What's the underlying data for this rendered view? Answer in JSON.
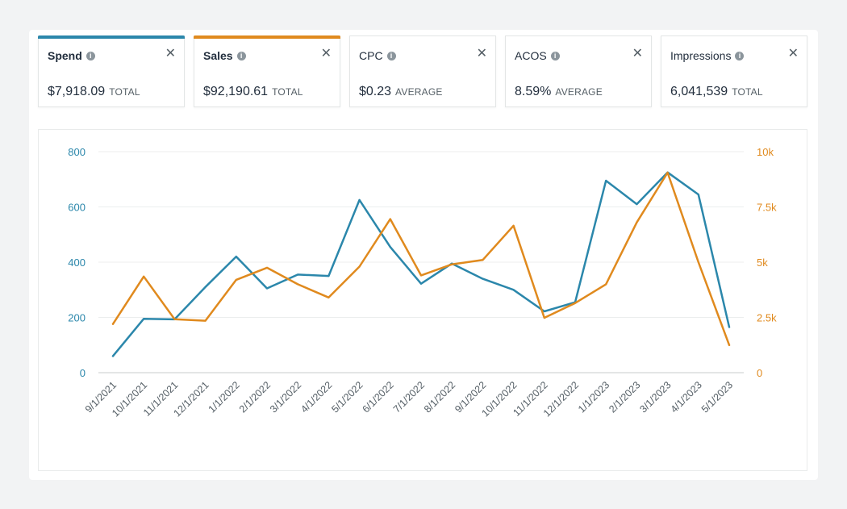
{
  "metrics": [
    {
      "name": "Spend",
      "value": "$7,918.09",
      "unit": "TOTAL",
      "active": true,
      "color": "#2b87ab"
    },
    {
      "name": "Sales",
      "value": "$92,190.61",
      "unit": "TOTAL",
      "active": true,
      "color": "#e08a1e"
    },
    {
      "name": "CPC",
      "value": "$0.23",
      "unit": "AVERAGE",
      "active": false,
      "color": ""
    },
    {
      "name": "ACOS",
      "value": "8.59%",
      "unit": "AVERAGE",
      "active": false,
      "color": ""
    },
    {
      "name": "Impressions",
      "value": "6,041,539",
      "unit": "TOTAL",
      "active": false,
      "color": ""
    }
  ],
  "icons": {
    "info": "info-icon",
    "close": "close-icon"
  },
  "chart_data": {
    "type": "line",
    "categories": [
      "9/1/2021",
      "10/1/2021",
      "11/1/2021",
      "12/1/2021",
      "1/1/2022",
      "2/1/2022",
      "3/1/2022",
      "4/1/2022",
      "5/1/2022",
      "6/1/2022",
      "7/1/2022",
      "8/1/2022",
      "9/1/2022",
      "10/1/2022",
      "11/1/2022",
      "12/1/2022",
      "1/1/2023",
      "2/1/2023",
      "3/1/2023",
      "4/1/2023",
      "5/1/2023"
    ],
    "series": [
      {
        "name": "Spend",
        "axis": "left",
        "color": "#2b87ab",
        "values": [
          60,
          195,
          193,
          310,
          420,
          305,
          355,
          350,
          625,
          455,
          322,
          395,
          340,
          300,
          222,
          255,
          695,
          610,
          725,
          645,
          165
        ]
      },
      {
        "name": "Sales",
        "axis": "right",
        "color": "#e08a1e",
        "values": [
          2200,
          4350,
          2420,
          2350,
          4200,
          4750,
          4000,
          3400,
          4800,
          6950,
          4400,
          4900,
          5100,
          6650,
          2480,
          3150,
          4000,
          6800,
          9050,
          5000,
          1250
        ]
      }
    ],
    "y_left": {
      "ylim": [
        0,
        800
      ],
      "ticks": [
        "0",
        "200",
        "400",
        "600",
        "800"
      ],
      "tick_values": [
        0,
        200,
        400,
        600,
        800
      ]
    },
    "y_right": {
      "ylim": [
        0,
        10000
      ],
      "ticks": [
        "0",
        "2.5k",
        "5k",
        "7.5k",
        "10k"
      ],
      "tick_values": [
        0,
        2500,
        5000,
        7500,
        10000
      ]
    },
    "grid": true,
    "legend": "none",
    "title": "",
    "xlabel": "",
    "ylabel": ""
  }
}
